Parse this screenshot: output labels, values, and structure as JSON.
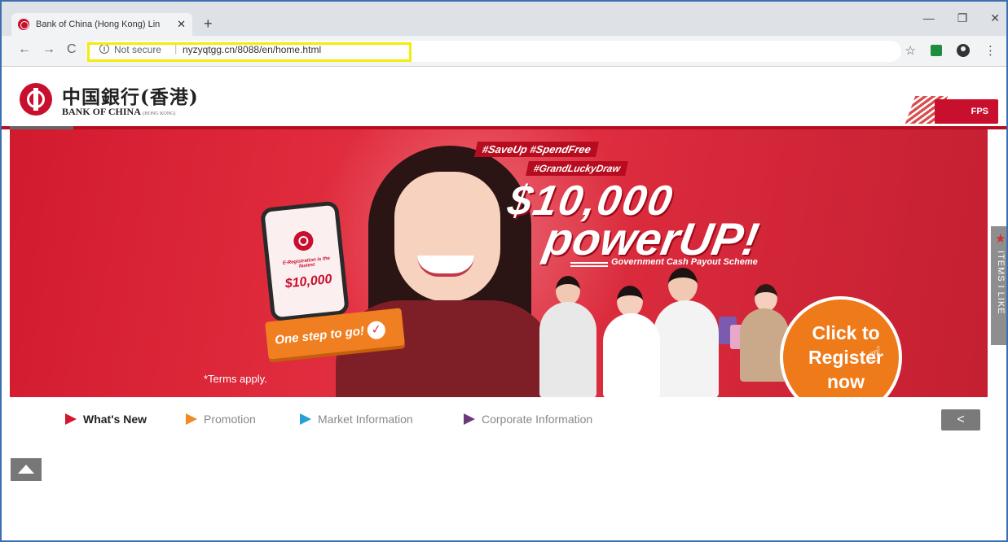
{
  "browser": {
    "tab_title": "Bank of China (Hong Kong) Lin",
    "tab_close": "✕",
    "new_tab": "+",
    "window_controls": [
      "—",
      "❐",
      "✕"
    ],
    "nav": {
      "back": "←",
      "forward": "→",
      "reload": "C"
    },
    "security_label": "Not secure",
    "url": "nyzyqtgg.cn/8088/en/home.html",
    "bookmark_icon": "☆",
    "menu_icon": "⋮",
    "highlight_color": "#f4ec0a"
  },
  "site": {
    "logo_cn": "中国銀行(香港)",
    "logo_en": "BANK OF CHINA",
    "logo_en_small": "(HONG KONG)",
    "fps_label": "FPS",
    "brand_color": "#c8102e"
  },
  "banner": {
    "hashtag1": "#SaveUp #SpendFree",
    "hashtag2": "#GrandLuckyDraw",
    "amount": "$10,000",
    "headline": "powerUP!",
    "scheme": "Government Cash Payout Scheme",
    "phone_text": "E-Registration is the fastest",
    "phone_amount": "$10,000",
    "step_label": "One step to go!",
    "terms": "*Terms apply.",
    "register_cta": "Click to Register now"
  },
  "side_tab": {
    "label": "ITEMS I LIKE"
  },
  "nav": {
    "items": [
      {
        "label": "What's New",
        "color": "#d3172d"
      },
      {
        "label": "Promotion",
        "color": "#f08a24"
      },
      {
        "label": "Market Information",
        "color": "#2a9fd6"
      },
      {
        "label": "Corporate Information",
        "color": "#6b3a7c"
      }
    ],
    "share_icon": "<"
  }
}
